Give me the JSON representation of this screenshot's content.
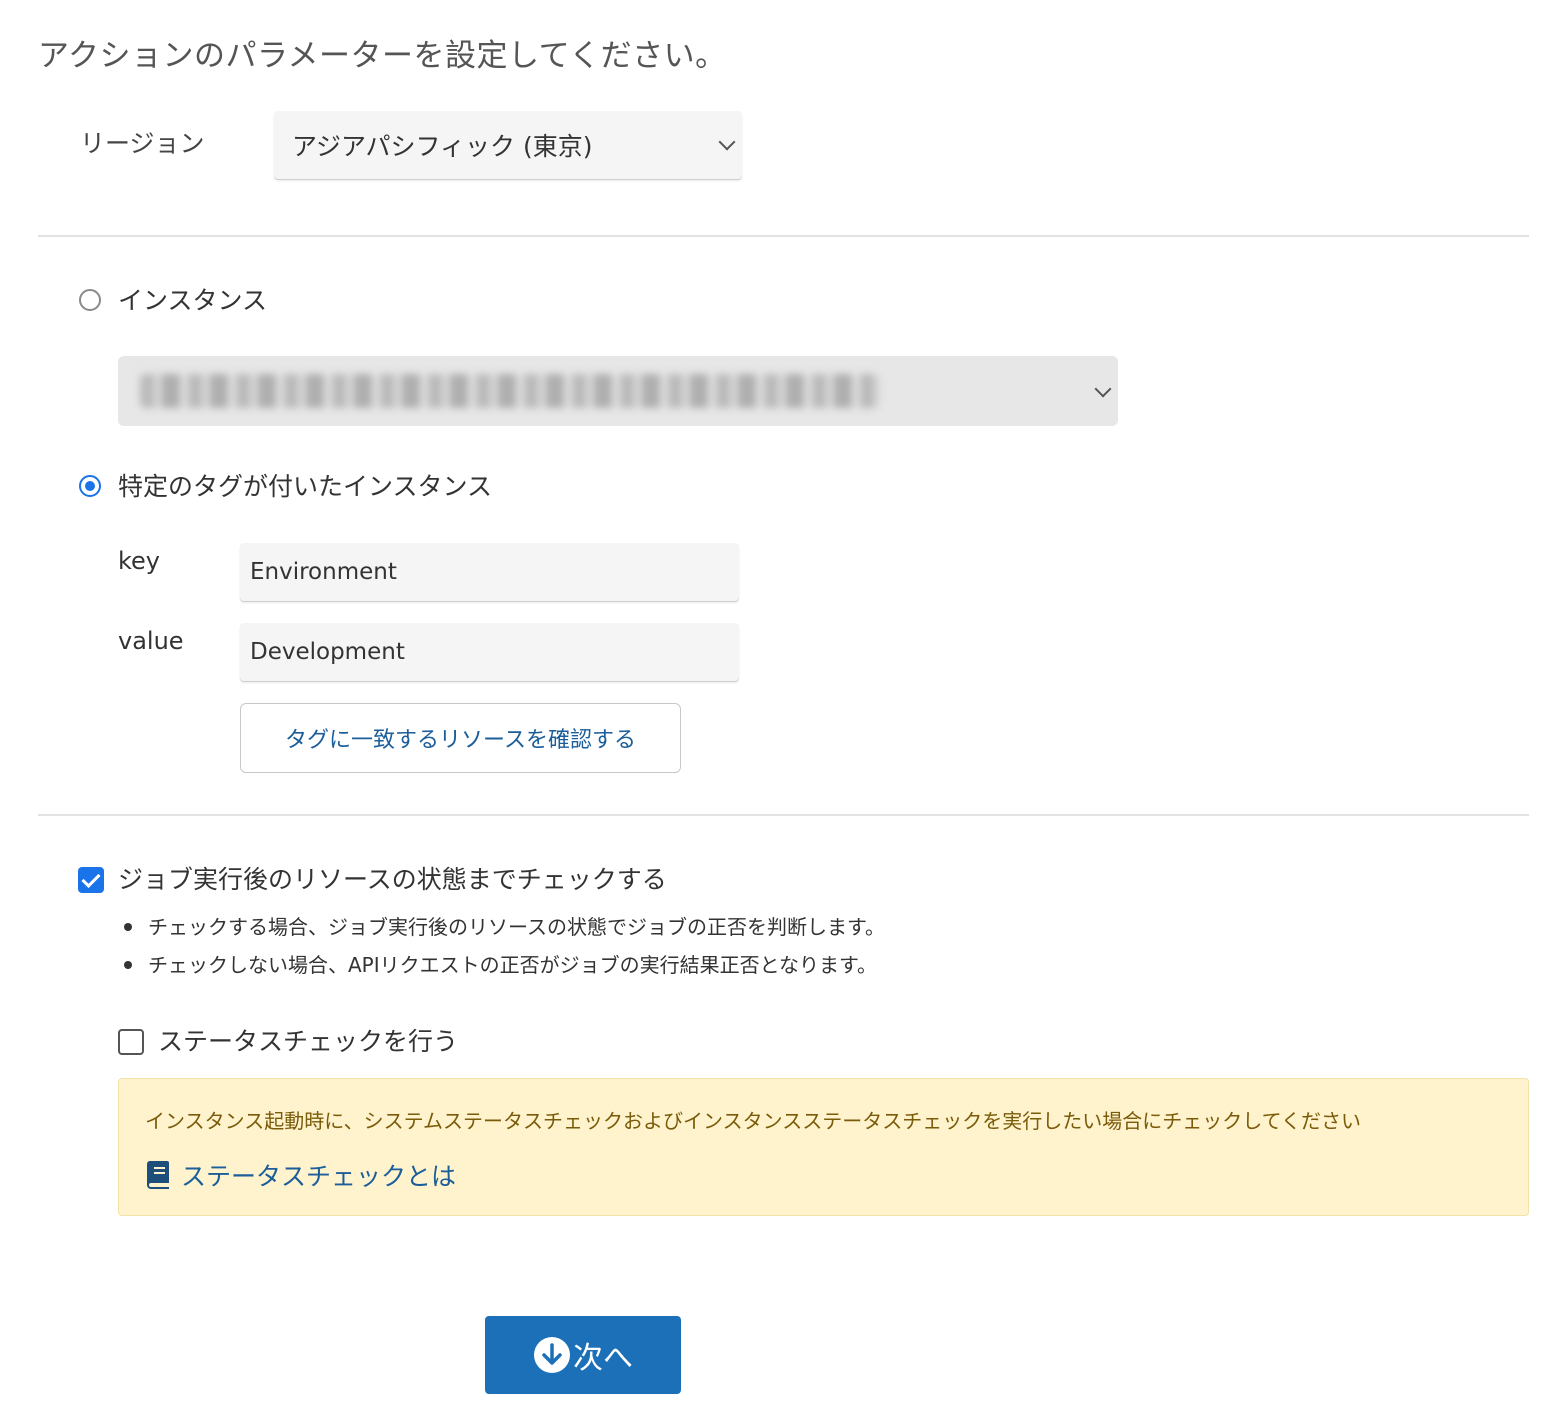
{
  "page": {
    "title": "アクションのパラメーターを設定してください。"
  },
  "region": {
    "label": "リージョン",
    "selected": "アジアパシフィック (東京)"
  },
  "target": {
    "instance_option_label": "インスタンス",
    "instance_option_selected": false,
    "instance_select_value": "(blurred)",
    "tag_option_label": "特定のタグが付いたインスタンス",
    "tag_option_selected": true,
    "key_label": "key",
    "key_value": "Environment",
    "value_label": "value",
    "value_value": "Development",
    "check_button_label": "タグに一致するリソースを確認する"
  },
  "resource_check": {
    "label": "ジョブ実行後のリソースの状態までチェックする",
    "checked": true,
    "notes": [
      "チェックする場合、ジョブ実行後のリソースの状態でジョブの正否を判断します。",
      "チェックしない場合、APIリクエストの正否がジョブの実行結果正否となります。"
    ]
  },
  "status_check": {
    "label": "ステータスチェックを行う",
    "checked": false,
    "notice_text": "インスタンス起動時に、システムステータスチェックおよびインスタンスステータスチェックを実行したい場合にチェックしてください",
    "link_label": "ステータスチェックとは",
    "link_icon": "book-icon"
  },
  "actions": {
    "next_label": "次へ",
    "next_icon": "arrow-down-circle-icon"
  },
  "colors": {
    "accent": "#1a73e8",
    "primary_button": "#1c70b8",
    "link": "#1b5e9a",
    "notice_bg": "#fff3cd",
    "notice_text": "#7a5b09"
  }
}
